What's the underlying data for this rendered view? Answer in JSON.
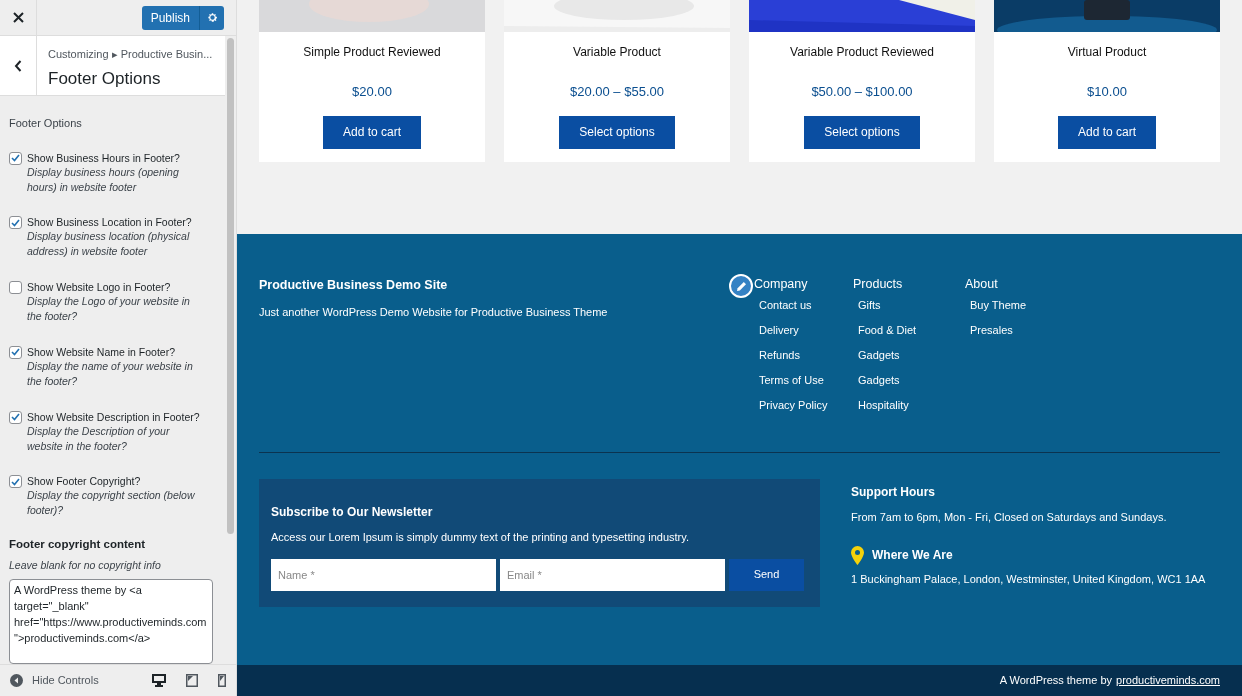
{
  "customizer": {
    "publish_label": "Publish",
    "breadcrumb": "Customizing ▸ Productive Busin...",
    "panel_title": "Footer Options",
    "section_title": "Footer Options",
    "options": [
      {
        "label": "Show Business Hours in Footer?",
        "description": "Display business hours (opening hours) in website footer",
        "checked": true
      },
      {
        "label": "Show Business Location in Footer?",
        "description": "Display business location (physical address) in website footer",
        "checked": true
      },
      {
        "label": "Show Website Logo in Footer?",
        "description": "Display the Logo of your website in the footer?",
        "checked": false
      },
      {
        "label": "Show Website Name in Footer?",
        "description": "Display the name of your website in the footer?",
        "checked": true
      },
      {
        "label": "Show Website Description in Footer?",
        "description": "Display the Description of your website in the footer?",
        "checked": true
      },
      {
        "label": "Show Footer Copyright?",
        "description": "Display the copyright section (below footer)?",
        "checked": true
      }
    ],
    "copyright_field": {
      "label": "Footer copyright content",
      "hint": "Leave blank for no copyright info",
      "value": "A WordPress theme by <a target=\"_blank\" href=\"https://www.productiveminds.com\">productiveminds.com</a>"
    },
    "hide_controls_label": "Hide Controls"
  },
  "products": [
    {
      "name": "Simple Product Reviewed",
      "price": "$20.00",
      "button": "Add to cart"
    },
    {
      "name": "Variable Product",
      "price": "$20.00 – $55.00",
      "button": "Select options"
    },
    {
      "name": "Variable Product Reviewed",
      "price": "$50.00 – $100.00",
      "button": "Select options"
    },
    {
      "name": "Virtual Product",
      "price": "$10.00",
      "button": "Add to cart"
    }
  ],
  "footer": {
    "site_name": "Productive Business Demo Site",
    "site_description": "Just another WordPress Demo Website for Productive Business Theme",
    "menus": [
      {
        "title": "Company",
        "links": [
          "Contact us",
          "Delivery",
          "Refunds",
          "Terms of Use",
          "Privacy Policy"
        ]
      },
      {
        "title": "Products",
        "links": [
          "Gifts",
          "Food & Diet",
          "Gadgets",
          "Gadgets",
          "Hospitality"
        ]
      },
      {
        "title": "About",
        "links": [
          "Buy Theme",
          "Presales"
        ]
      }
    ],
    "newsletter": {
      "title": "Subscribe to Our Newsletter",
      "text": "Access our Lorem Ipsum is simply dummy text of the printing and typesetting industry.",
      "name_placeholder": "Name *",
      "email_placeholder": "Email *",
      "button": "Send"
    },
    "support_title": "Support Hours",
    "support_text": "From 7am to 6pm, Mon - Fri, Closed on Saturdays and Sundays.",
    "location_title": "Where We Are",
    "location_text": "1 Buckingham Palace, London, Westminster, United Kingdom, WC1 1AA",
    "copyright_prefix": "A WordPress theme by",
    "copyright_link": "productiveminds.com"
  }
}
